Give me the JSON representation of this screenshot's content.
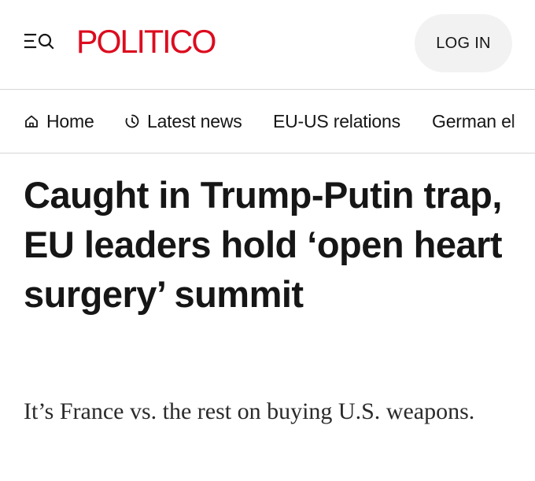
{
  "header": {
    "logo_text": "POLITICO",
    "login_label": "LOG IN",
    "menu_icon": "menu-search-icon",
    "brand_color": "#dc0c1f"
  },
  "nav": {
    "items": [
      {
        "label": "Home",
        "icon": "home-icon"
      },
      {
        "label": "Latest news",
        "icon": "clock-icon"
      },
      {
        "label": "EU-US relations",
        "icon": ""
      },
      {
        "label": "German el",
        "icon": ""
      }
    ]
  },
  "article": {
    "headline": "Caught in Trump-Putin trap, EU leaders hold ‘open heart surgery’ summit",
    "dek": "It’s France vs. the rest on buying U.S. weapons."
  }
}
